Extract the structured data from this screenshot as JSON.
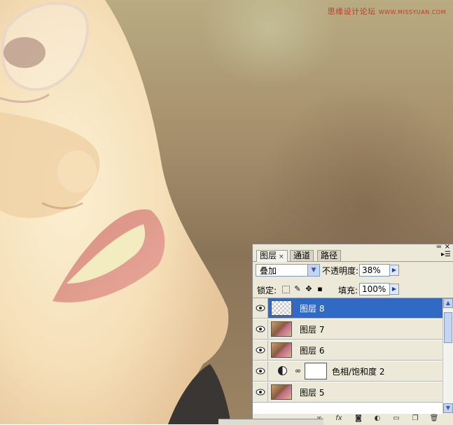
{
  "watermark": {
    "text": "思缘设计论坛",
    "url": "WWW.MISSYUAN.COM"
  },
  "panel": {
    "tabs": [
      {
        "label": "图层",
        "close": "×"
      },
      {
        "label": "通道"
      },
      {
        "label": "路径"
      }
    ],
    "minimize_glyph": "=",
    "close_glyph": "×",
    "menu_glyph": "▸☰",
    "blend_mode": "叠加",
    "opacity_label": "不透明度:",
    "opacity_value": "38%",
    "lock_label": "锁定:",
    "fill_label": "填充:",
    "fill_value": "100%",
    "layers": [
      {
        "name": "图层 8",
        "thumb": "transparent",
        "selected": true
      },
      {
        "name": "图层 7",
        "thumb": "photo"
      },
      {
        "name": "图层 6",
        "thumb": "photo"
      },
      {
        "name": "色相/饱和度 2",
        "thumb": "adjustment"
      },
      {
        "name": "图层 5",
        "thumb": "photo"
      }
    ],
    "bottom_icons": [
      "link-layers",
      "fx",
      "add-mask",
      "adjustment",
      "new-group",
      "new-layer",
      "delete"
    ]
  },
  "colors": {
    "selection": "#316ac5",
    "panel_bg": "#ece9d8",
    "watermark": "#c03a2b"
  }
}
